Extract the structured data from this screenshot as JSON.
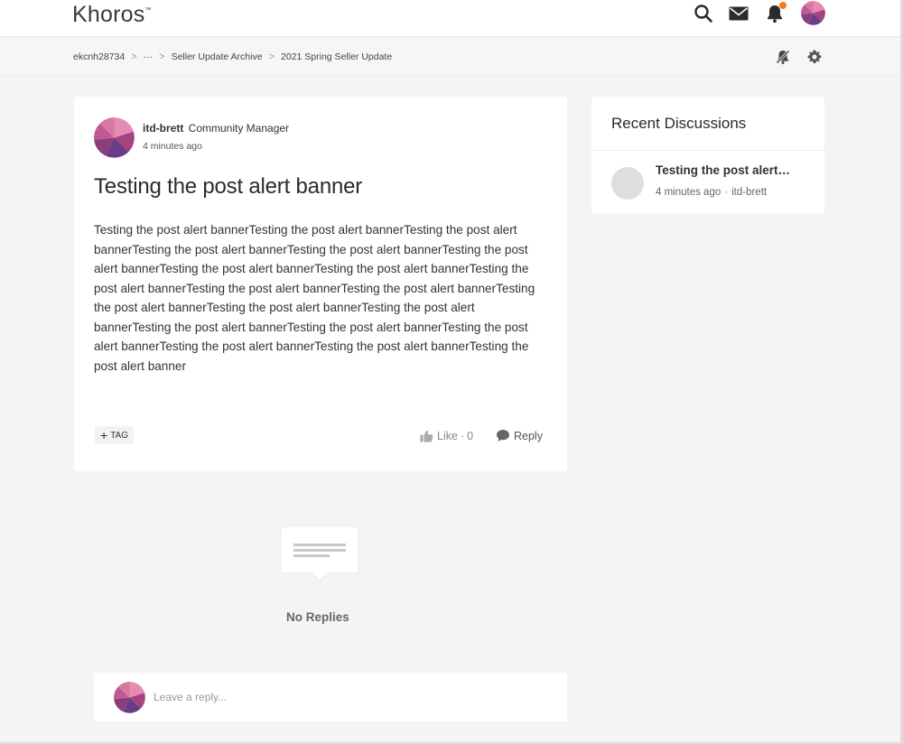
{
  "header": {
    "logo_text": "Khoros",
    "logo_mark": "™",
    "icons": [
      "search-icon",
      "mail-icon",
      "bell-icon",
      "avatar"
    ],
    "notification_dot_color": "#f07f22"
  },
  "breadcrumb": {
    "items": [
      "ekcnh28734",
      "···",
      "Seller Update Archive",
      "2021 Spring Seller Update"
    ],
    "separator": ">",
    "tools": [
      "notify-icon",
      "settings-icon"
    ]
  },
  "post": {
    "author": "itd-brett",
    "rank": "Community Manager",
    "time": "4 minutes ago",
    "title": "Testing the post alert banner",
    "body": "Testing the post alert bannerTesting the post alert bannerTesting the post alert bannerTesting the post alert bannerTesting the post alert bannerTesting the post alert bannerTesting the post alert bannerTesting the post alert bannerTesting the post alert bannerTesting the post alert bannerTesting the post alert bannerTesting the post alert bannerTesting the post alert bannerTesting the post alert bannerTesting the post alert bannerTesting the post alert bannerTesting the post alert bannerTesting the post alert bannerTesting the post alert bannerTesting the post alert banner",
    "tag_label": "TAG",
    "like_label": "Like",
    "like_count": "0",
    "reply_label": "Reply"
  },
  "sidebar": {
    "title": "Recent Discussions",
    "items": [
      {
        "title": "Testing the post alert…",
        "time": "4 minutes ago",
        "author": "itd-brett"
      }
    ]
  },
  "replies": {
    "empty_label": "No Replies"
  },
  "reply_box": {
    "placeholder": "Leave a reply..."
  },
  "colors": {
    "accent_orange": "#f07f22",
    "avatar_magenta": "#b8437d",
    "avatar_purple": "#6a3b86"
  }
}
